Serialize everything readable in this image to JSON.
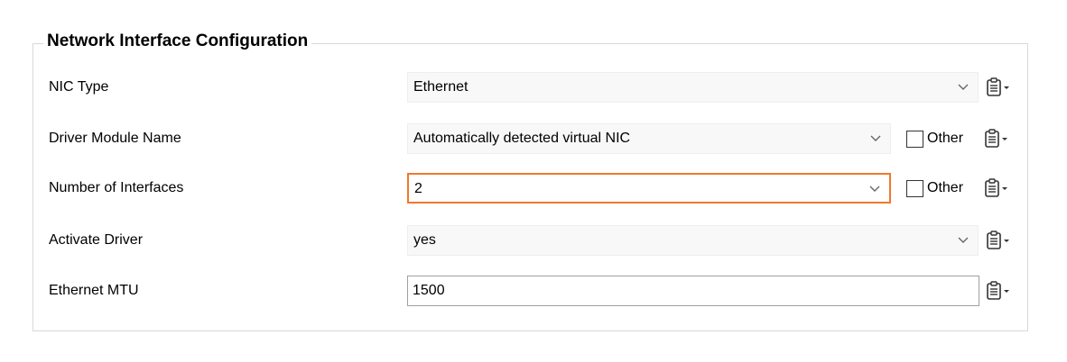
{
  "group": {
    "title": "Network Interface Configuration"
  },
  "fields": {
    "nic_type": {
      "label": "NIC Type",
      "value": "Ethernet"
    },
    "driver_module": {
      "label": "Driver Module Name",
      "value": "Automatically detected virtual NIC",
      "other_label": "Other"
    },
    "num_interfaces": {
      "label": "Number of Interfaces",
      "value": "2",
      "other_label": "Other"
    },
    "activate_driver": {
      "label": "Activate Driver",
      "value": "yes"
    },
    "ethernet_mtu": {
      "label": "Ethernet MTU",
      "value": "1500"
    }
  },
  "colors": {
    "focus_border": "#f0782d",
    "group_border": "#d8d8d8",
    "select_bg": "#f8f8f8"
  },
  "icons": {
    "dropdown": "chevron-down-icon",
    "options_menu": "clipboard-menu-icon"
  }
}
